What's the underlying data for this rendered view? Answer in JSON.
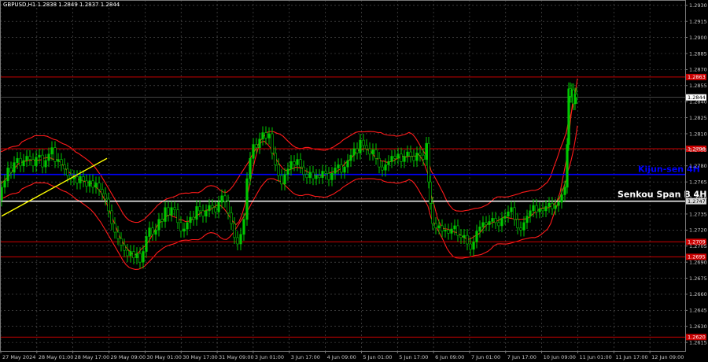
{
  "chart_data": {
    "type": "line",
    "title": "GBPUSD,H1  1.2838 1.2849 1.2837 1.2844",
    "colors": {
      "background": "#000000",
      "grid": "#5a5a5a",
      "axis_text": "#c8c8c8",
      "candle_up": "#00c800",
      "candle_down": "#00c800",
      "ichimoku": "#ff1a1a",
      "kijun": "#0000ff",
      "senkou": "#ffffff",
      "levels": "#cc0000",
      "trend": "#ffff00"
    },
    "ylim": [
      1.2607,
      1.2935
    ],
    "y_ticks": [
      "1.2930",
      "1.2915",
      "1.2900",
      "1.2885",
      "1.2870",
      "1.2855",
      "1.2840",
      "1.2825",
      "1.2810",
      "1.2795",
      "1.2780",
      "1.2765",
      "1.2750",
      "1.2735",
      "1.2720",
      "1.2705",
      "1.2690",
      "1.2675",
      "1.2660",
      "1.2645",
      "1.2630",
      "1.2615"
    ],
    "x_ticks": [
      "27 May 2024",
      "28 May 01:00",
      "28 May 17:00",
      "29 May 09:00",
      "30 May 01:00",
      "30 May 17:00",
      "31 May 09:00",
      "3 Jun 01:00",
      "3 Jun 17:00",
      "4 Jun 09:00",
      "5 Jun 01:00",
      "5 Jun 17:00",
      "6 Jun 09:00",
      "7 Jun 01:00",
      "7 Jun 17:00",
      "10 Jun 09:00",
      "11 Jun 01:00",
      "11 Jun 17:00",
      "12 Jun 09:00"
    ],
    "current_price": "1.2844",
    "levels": [
      {
        "value": 1.2863,
        "label": "1.2863",
        "color": "#cc0000"
      },
      {
        "value": 1.2796,
        "label": "1.2796",
        "color": "#cc0000"
      },
      {
        "value": 1.2709,
        "label": "1.2709",
        "color": "#cc0000"
      },
      {
        "value": 1.2695,
        "label": "1.2695",
        "color": "#cc0000"
      },
      {
        "value": 1.262,
        "label": "1.2620",
        "color": "#cc0000"
      }
    ],
    "kijun": {
      "value": 1.2772,
      "label": "Kijun-sen 4H",
      "color": "#0000ff"
    },
    "senkou": {
      "value": 1.2747,
      "label": "Senkou Span B 4H",
      "price_label": "1.2747",
      "color": "#ffffff"
    },
    "price_path": [
      [
        0,
        1.2748
      ],
      [
        4,
        1.276
      ],
      [
        8,
        1.2766
      ],
      [
        12,
        1.2778
      ],
      [
        16,
        1.2774
      ],
      [
        20,
        1.2783
      ],
      [
        24,
        1.2787
      ],
      [
        28,
        1.278
      ],
      [
        32,
        1.2785
      ],
      [
        36,
        1.2789
      ],
      [
        40,
        1.2786
      ],
      [
        44,
        1.278
      ],
      [
        48,
        1.2788
      ],
      [
        52,
        1.279
      ],
      [
        56,
        1.2779
      ],
      [
        60,
        1.2785
      ],
      [
        64,
        1.2791
      ],
      [
        68,
        1.2797
      ],
      [
        72,
        1.2784
      ],
      [
        76,
        1.2786
      ],
      [
        80,
        1.2781
      ],
      [
        84,
        1.2777
      ],
      [
        88,
        1.2771
      ],
      [
        92,
        1.2768
      ],
      [
        96,
        1.277
      ],
      [
        100,
        1.2764
      ],
      [
        104,
        1.277
      ],
      [
        108,
        1.2766
      ],
      [
        112,
        1.2761
      ],
      [
        116,
        1.2766
      ],
      [
        120,
        1.276
      ],
      [
        124,
        1.2764
      ],
      [
        128,
        1.2758
      ],
      [
        132,
        1.2754
      ],
      [
        136,
        1.2749
      ],
      [
        140,
        1.2738
      ],
      [
        144,
        1.2726
      ],
      [
        148,
        1.2718
      ],
      [
        152,
        1.2712
      ],
      [
        156,
        1.2706
      ],
      [
        160,
        1.2701
      ],
      [
        164,
        1.2696
      ],
      [
        168,
        1.27
      ],
      [
        172,
        1.2694
      ],
      [
        176,
        1.2698
      ],
      [
        180,
        1.269
      ],
      [
        184,
        1.27
      ],
      [
        188,
        1.2714
      ],
      [
        192,
        1.2722
      ],
      [
        196,
        1.2716
      ],
      [
        200,
        1.272
      ],
      [
        204,
        1.273
      ],
      [
        208,
        1.2728
      ],
      [
        212,
        1.2741
      ],
      [
        216,
        1.2734
      ],
      [
        220,
        1.2741
      ],
      [
        224,
        1.2739
      ],
      [
        228,
        1.2727
      ],
      [
        232,
        1.2719
      ],
      [
        236,
        1.2721
      ],
      [
        240,
        1.2727
      ],
      [
        244,
        1.2732
      ],
      [
        248,
        1.273
      ],
      [
        252,
        1.2742
      ],
      [
        256,
        1.2738
      ],
      [
        260,
        1.2733
      ],
      [
        264,
        1.2738
      ],
      [
        268,
        1.2743
      ],
      [
        272,
        1.2741
      ],
      [
        276,
        1.2737
      ],
      [
        280,
        1.2746
      ],
      [
        284,
        1.2752
      ],
      [
        288,
        1.2747
      ],
      [
        292,
        1.2736
      ],
      [
        296,
        1.2726
      ],
      [
        300,
        1.2713
      ],
      [
        304,
        1.2707
      ],
      [
        308,
        1.2716
      ],
      [
        312,
        1.273
      ],
      [
        316,
        1.2768
      ],
      [
        320,
        1.2787
      ],
      [
        324,
        1.28
      ],
      [
        328,
        1.2797
      ],
      [
        332,
        1.2805
      ],
      [
        336,
        1.2811
      ],
      [
        340,
        1.2806
      ],
      [
        344,
        1.281
      ],
      [
        348,
        1.2792
      ],
      [
        352,
        1.2781
      ],
      [
        356,
        1.2771
      ],
      [
        360,
        1.2763
      ],
      [
        364,
        1.2772
      ],
      [
        368,
        1.2777
      ],
      [
        372,
        1.2784
      ],
      [
        376,
        1.2781
      ],
      [
        380,
        1.2786
      ],
      [
        384,
        1.2779
      ],
      [
        388,
        1.2772
      ],
      [
        392,
        1.2769
      ],
      [
        396,
        1.2774
      ],
      [
        400,
        1.2768
      ],
      [
        404,
        1.2771
      ],
      [
        408,
        1.2769
      ],
      [
        412,
        1.2775
      ],
      [
        416,
        1.2773
      ],
      [
        420,
        1.2767
      ],
      [
        424,
        1.2773
      ],
      [
        428,
        1.2778
      ],
      [
        432,
        1.2781
      ],
      [
        436,
        1.2774
      ],
      [
        440,
        1.2779
      ],
      [
        444,
        1.2785
      ],
      [
        448,
        1.279
      ],
      [
        452,
        1.2796
      ],
      [
        456,
        1.2792
      ],
      [
        460,
        1.2804
      ],
      [
        464,
        1.2799
      ],
      [
        468,
        1.2796
      ],
      [
        472,
        1.2791
      ],
      [
        476,
        1.2795
      ],
      [
        480,
        1.2787
      ],
      [
        484,
        1.2779
      ],
      [
        488,
        1.2776
      ],
      [
        492,
        1.2781
      ],
      [
        496,
        1.2784
      ],
      [
        500,
        1.2789
      ],
      [
        504,
        1.2787
      ],
      [
        508,
        1.2791
      ],
      [
        512,
        1.2784
      ],
      [
        516,
        1.2789
      ],
      [
        520,
        1.2793
      ],
      [
        524,
        1.2789
      ],
      [
        528,
        1.2785
      ],
      [
        532,
        1.2792
      ],
      [
        536,
        1.279
      ],
      [
        540,
        1.2786
      ],
      [
        544,
        1.2801
      ],
      [
        546,
        1.2765
      ],
      [
        548,
        1.2745
      ],
      [
        552,
        1.2726
      ],
      [
        556,
        1.2722
      ],
      [
        560,
        1.2724
      ],
      [
        564,
        1.2719
      ],
      [
        568,
        1.272
      ],
      [
        572,
        1.2717
      ],
      [
        576,
        1.2721
      ],
      [
        580,
        1.2724
      ],
      [
        584,
        1.2715
      ],
      [
        588,
        1.2713
      ],
      [
        592,
        1.2715
      ],
      [
        596,
        1.2707
      ],
      [
        600,
        1.2702
      ],
      [
        604,
        1.2709
      ],
      [
        608,
        1.2719
      ],
      [
        612,
        1.2723
      ],
      [
        616,
        1.2727
      ],
      [
        620,
        1.2725
      ],
      [
        624,
        1.2728
      ],
      [
        628,
        1.2731
      ],
      [
        632,
        1.2727
      ],
      [
        636,
        1.2724
      ],
      [
        640,
        1.2731
      ],
      [
        644,
        1.2733
      ],
      [
        648,
        1.2737
      ],
      [
        652,
        1.2741
      ],
      [
        656,
        1.273
      ],
      [
        660,
        1.2722
      ],
      [
        664,
        1.272
      ],
      [
        668,
        1.2727
      ],
      [
        672,
        1.2733
      ],
      [
        676,
        1.2738
      ],
      [
        680,
        1.2743
      ],
      [
        684,
        1.2737
      ],
      [
        688,
        1.274
      ],
      [
        692,
        1.2738
      ],
      [
        696,
        1.2742
      ],
      [
        700,
        1.2745
      ],
      [
        704,
        1.274
      ],
      [
        708,
        1.2743
      ],
      [
        712,
        1.2746
      ],
      [
        716,
        1.2753
      ],
      [
        720,
        1.276
      ],
      [
        722,
        1.28
      ],
      [
        724,
        1.2852
      ],
      [
        726,
        1.2845
      ],
      [
        728,
        1.2851
      ],
      [
        730,
        1.2838
      ],
      [
        732,
        1.2847
      ],
      [
        734,
        1.2844
      ]
    ]
  }
}
